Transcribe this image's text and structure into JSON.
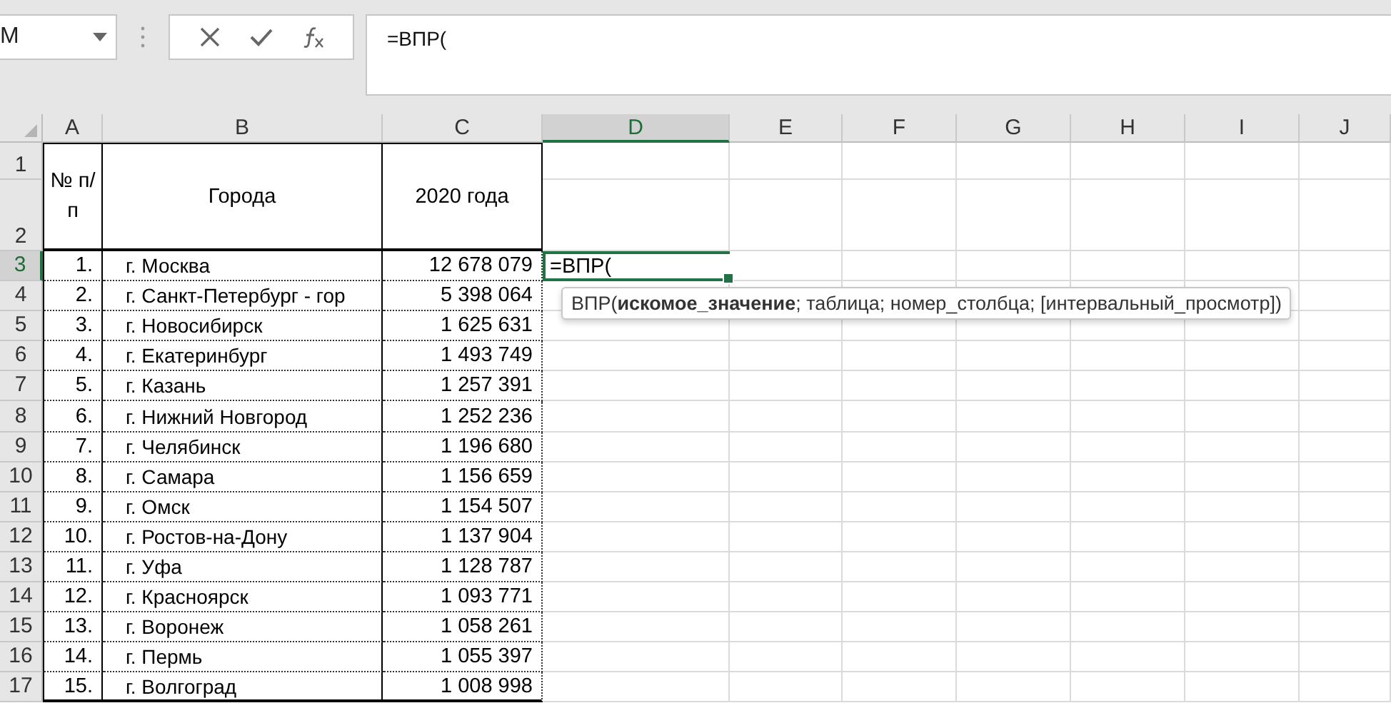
{
  "name_box": {
    "value": "M"
  },
  "formula_bar": {
    "value": "=ВПР("
  },
  "columns": [
    {
      "label": "A",
      "selected": false
    },
    {
      "label": "B",
      "selected": false
    },
    {
      "label": "C",
      "selected": false
    },
    {
      "label": "D",
      "selected": true
    },
    {
      "label": "E",
      "selected": false
    },
    {
      "label": "F",
      "selected": false
    },
    {
      "label": "G",
      "selected": false
    },
    {
      "label": "H",
      "selected": false
    },
    {
      "label": "I",
      "selected": false
    },
    {
      "label": "J",
      "selected": false
    }
  ],
  "header_rows": [
    {
      "number": "1",
      "selected": false
    },
    {
      "number": "2",
      "selected": false
    }
  ],
  "header": {
    "number": "№ п/п",
    "city": "Города",
    "population": "2020 года"
  },
  "rows": [
    {
      "number": "3",
      "selected": true,
      "cells": [
        "1.",
        "г. Москва",
        "12 678 079"
      ]
    },
    {
      "number": "4",
      "selected": false,
      "cells": [
        "2.",
        "г. Санкт-Петербург - гор",
        "5 398 064"
      ]
    },
    {
      "number": "5",
      "selected": false,
      "cells": [
        "3.",
        "г. Новосибирск",
        "1 625 631"
      ]
    },
    {
      "number": "6",
      "selected": false,
      "cells": [
        "4.",
        "г. Екатеринбург",
        "1 493 749"
      ]
    },
    {
      "number": "7",
      "selected": false,
      "cells": [
        "5.",
        "г. Казань",
        "1 257 391"
      ]
    },
    {
      "number": "8",
      "selected": false,
      "cells": [
        "6.",
        "г. Нижний Новгород",
        "1 252 236"
      ]
    },
    {
      "number": "9",
      "selected": false,
      "cells": [
        "7.",
        "г. Челябинск",
        "1 196 680"
      ]
    },
    {
      "number": "10",
      "selected": false,
      "cells": [
        "8.",
        "г. Самара",
        "1 156 659"
      ]
    },
    {
      "number": "11",
      "selected": false,
      "cells": [
        "9.",
        "г. Омск",
        "1 154 507"
      ]
    },
    {
      "number": "12",
      "selected": false,
      "cells": [
        "10.",
        "г. Ростов-на-Дону",
        "1 137 904"
      ]
    },
    {
      "number": "13",
      "selected": false,
      "cells": [
        "11.",
        "г. Уфа",
        "1 128 787"
      ]
    },
    {
      "number": "14",
      "selected": false,
      "cells": [
        "12.",
        "г. Красноярск",
        "1 093 771"
      ]
    },
    {
      "number": "15",
      "selected": false,
      "cells": [
        "13.",
        "г. Воронеж",
        "1 058 261"
      ]
    },
    {
      "number": "16",
      "selected": false,
      "cells": [
        "14.",
        "г. Пермь",
        "1 055 397"
      ]
    },
    {
      "number": "17",
      "selected": false,
      "cells": [
        "15.",
        "г. Волгоград",
        "1 008 998"
      ]
    }
  ],
  "active_cell": {
    "value": "=ВПР("
  },
  "tooltip": {
    "text": "ВПР(**искомое_значение**; таблица; номер_столбца; [интервальный_просмотр])"
  }
}
